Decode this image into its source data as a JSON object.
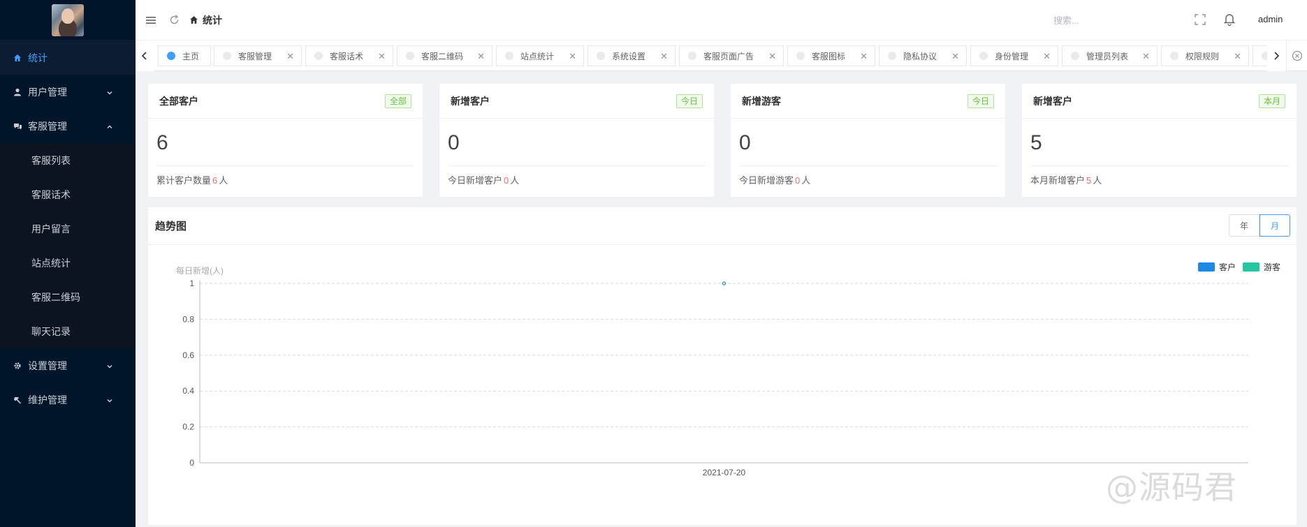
{
  "sidebar": {
    "items": [
      {
        "label": "统计",
        "active": true
      },
      {
        "label": "用户管理"
      },
      {
        "label": "客服管理",
        "expanded": true,
        "children": [
          "客服列表",
          "客服话术",
          "用户留言",
          "站点统计",
          "客服二维码",
          "聊天记录"
        ]
      },
      {
        "label": "设置管理"
      },
      {
        "label": "维护管理"
      }
    ]
  },
  "header": {
    "breadcrumb": "统计",
    "search_placeholder": "搜索...",
    "user": "admin"
  },
  "tabs": [
    {
      "label": "主页",
      "active": true,
      "closable": false
    },
    {
      "label": "客服管理"
    },
    {
      "label": "客服话术"
    },
    {
      "label": "客服二维码"
    },
    {
      "label": "站点统计"
    },
    {
      "label": "系统设置"
    },
    {
      "label": "客服页面广告"
    },
    {
      "label": "客服图标"
    },
    {
      "label": "隐私协议"
    },
    {
      "label": "身份管理"
    },
    {
      "label": "管理员列表"
    },
    {
      "label": "权限规则"
    }
  ],
  "cards": [
    {
      "title": "全部客户",
      "badge": "全部",
      "value": "6",
      "foot_prefix": "累计客户数量",
      "foot_num": "6",
      "foot_unit": "人"
    },
    {
      "title": "新增客户",
      "badge": "今日",
      "value": "0",
      "foot_prefix": "今日新增客户",
      "foot_num": "0",
      "foot_unit": "人"
    },
    {
      "title": "新增游客",
      "badge": "今日",
      "value": "0",
      "foot_prefix": "今日新增游客",
      "foot_num": "0",
      "foot_unit": "人"
    },
    {
      "title": "新增客户",
      "badge": "本月",
      "value": "5",
      "foot_prefix": "本月新增客户",
      "foot_num": "5",
      "foot_unit": "人"
    }
  ],
  "panel": {
    "title": "趋势图",
    "toggle": [
      "年",
      "月"
    ],
    "toggle_selected": "月"
  },
  "chart_data": {
    "type": "line",
    "ylabel": "每日新增(人)",
    "x": [
      "2021-07-20"
    ],
    "ylim": [
      0,
      1
    ],
    "yticks": [
      "0",
      "0.2",
      "0.4",
      "0.6",
      "0.8",
      "1"
    ],
    "series": [
      {
        "name": "客户",
        "values": [
          1
        ],
        "color": "#1e88e5"
      },
      {
        "name": "游客",
        "values": [
          null
        ],
        "color": "#26c6a0"
      }
    ],
    "legend": "top-right",
    "grid": true
  },
  "watermark": "@源码君"
}
